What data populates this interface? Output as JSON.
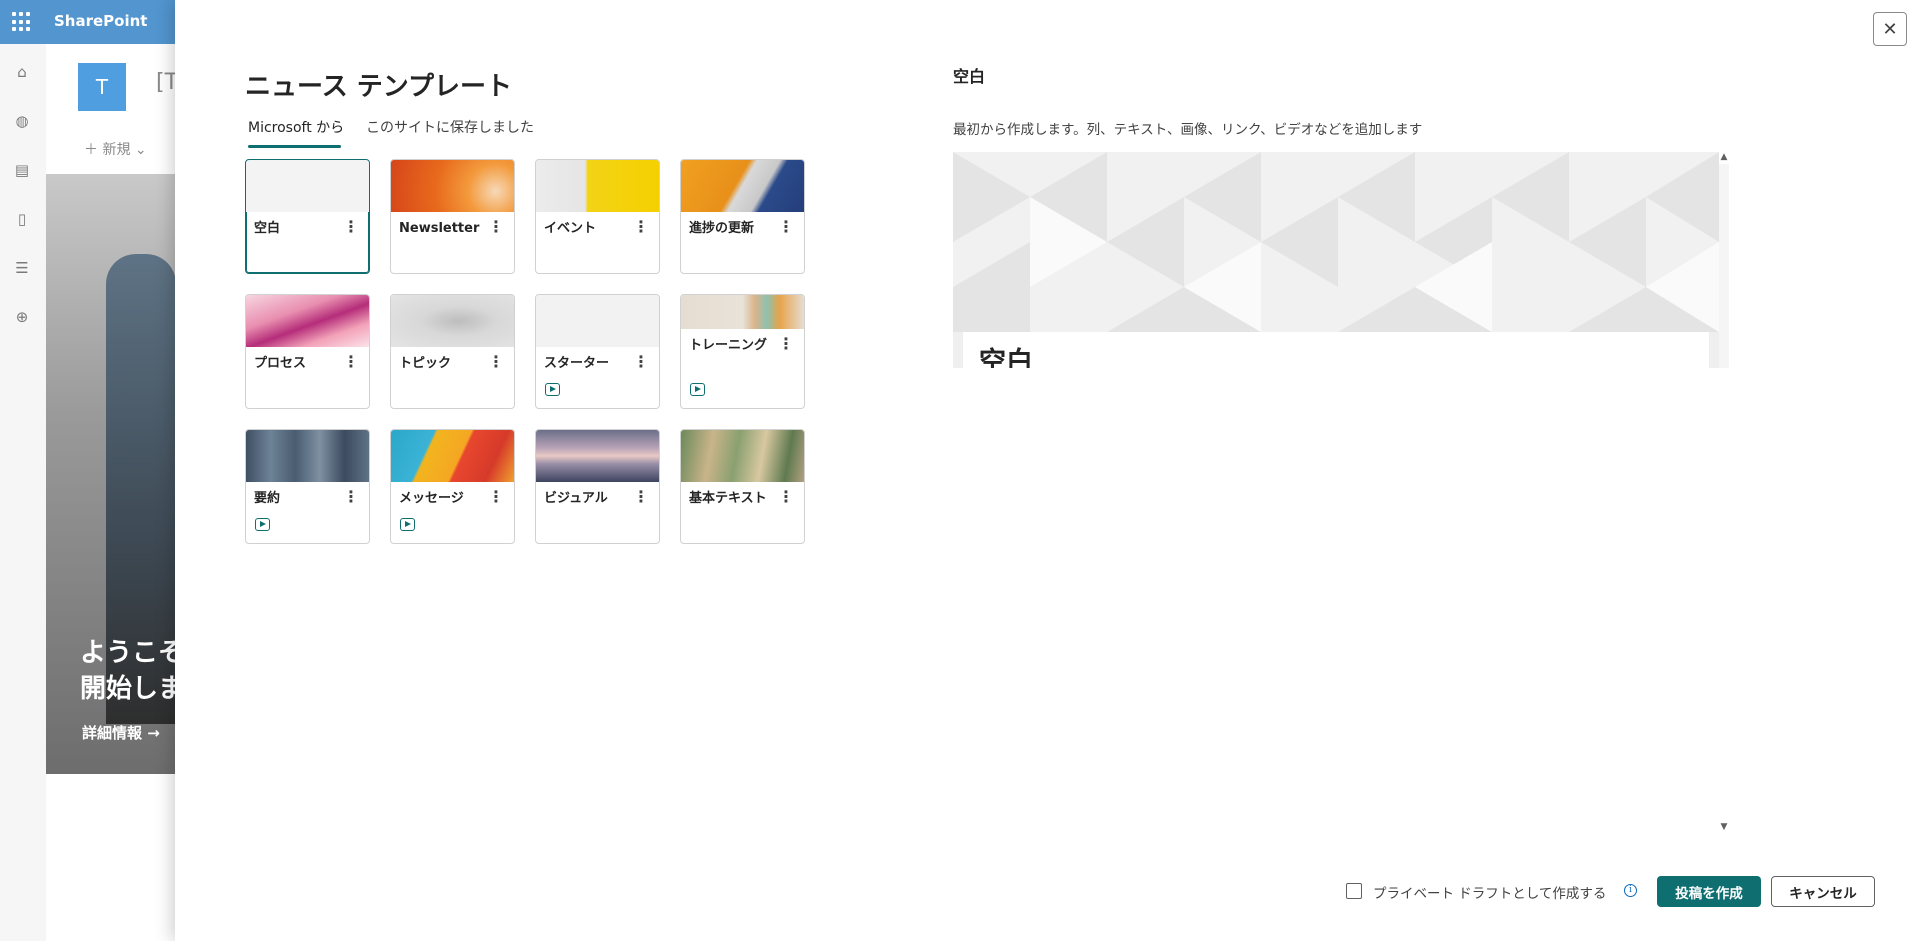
{
  "background": {
    "brand": "SharePoint",
    "site_logo_letter": "T",
    "site_title": "[T",
    "new_label": "＋ 新規 ⌄",
    "hero_line1": "ようこそ",
    "hero_line2": "開始しま",
    "hero_link": "詳細情報 →",
    "rail_icons": [
      "home-icon",
      "globe-icon",
      "news-icon",
      "document-icon",
      "list-icon",
      "add-icon"
    ]
  },
  "dialog": {
    "title": "ニュース テンプレート",
    "tabs": [
      {
        "label": "Microsoft から",
        "active": true
      },
      {
        "label": "このサイトに保存しました",
        "active": false
      }
    ],
    "templates": [
      {
        "label": "空白",
        "video": false,
        "selected": true
      },
      {
        "label": "Newsletter",
        "video": false,
        "selected": false
      },
      {
        "label": "イベント",
        "video": false,
        "selected": false
      },
      {
        "label": "進捗の更新",
        "video": false,
        "selected": false
      },
      {
        "label": "プロセス",
        "video": false,
        "selected": false
      },
      {
        "label": "トピック",
        "video": false,
        "selected": false
      },
      {
        "label": "スターター",
        "video": true,
        "selected": false
      },
      {
        "label": "トレーニング",
        "video": true,
        "selected": false
      },
      {
        "label": "要約",
        "video": true,
        "selected": false
      },
      {
        "label": "メッセージ",
        "video": true,
        "selected": false
      },
      {
        "label": "ビジュアル",
        "video": false,
        "selected": false
      },
      {
        "label": "基本テキスト",
        "video": false,
        "selected": false
      }
    ],
    "more_glyph": "⋮",
    "close_glyph": "✕"
  },
  "preview": {
    "title": "空白",
    "description": "最初から作成します。列、テキスト、画像、リンク、ビデオなどを追加します",
    "card_title": "空白"
  },
  "footer": {
    "private_draft_label": "プライベート ドラフトとして作成する",
    "info_glyph": "i",
    "create_label": "投稿を作成",
    "cancel_label": "キャンセル"
  },
  "colors": {
    "accent": "#0f6e70",
    "suite_bar": "#0f6cbd"
  }
}
